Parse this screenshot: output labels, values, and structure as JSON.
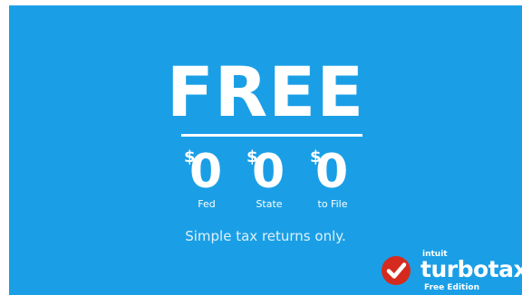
{
  "headline": "FREE",
  "prices": [
    {
      "currency": "$",
      "amount": "0",
      "label": "Fed"
    },
    {
      "currency": "$",
      "amount": "0",
      "label": "State"
    },
    {
      "currency": "$",
      "amount": "0",
      "label": "to File"
    }
  ],
  "tagline": "Simple tax returns only.",
  "logo": {
    "company": "intuit",
    "product": "turbotax",
    "edition": "Free Edition",
    "icon": "checkmark-icon"
  },
  "colors": {
    "background": "#1a9fe6",
    "text": "#ffffff",
    "checkmark_circle": "#d52b1e"
  }
}
